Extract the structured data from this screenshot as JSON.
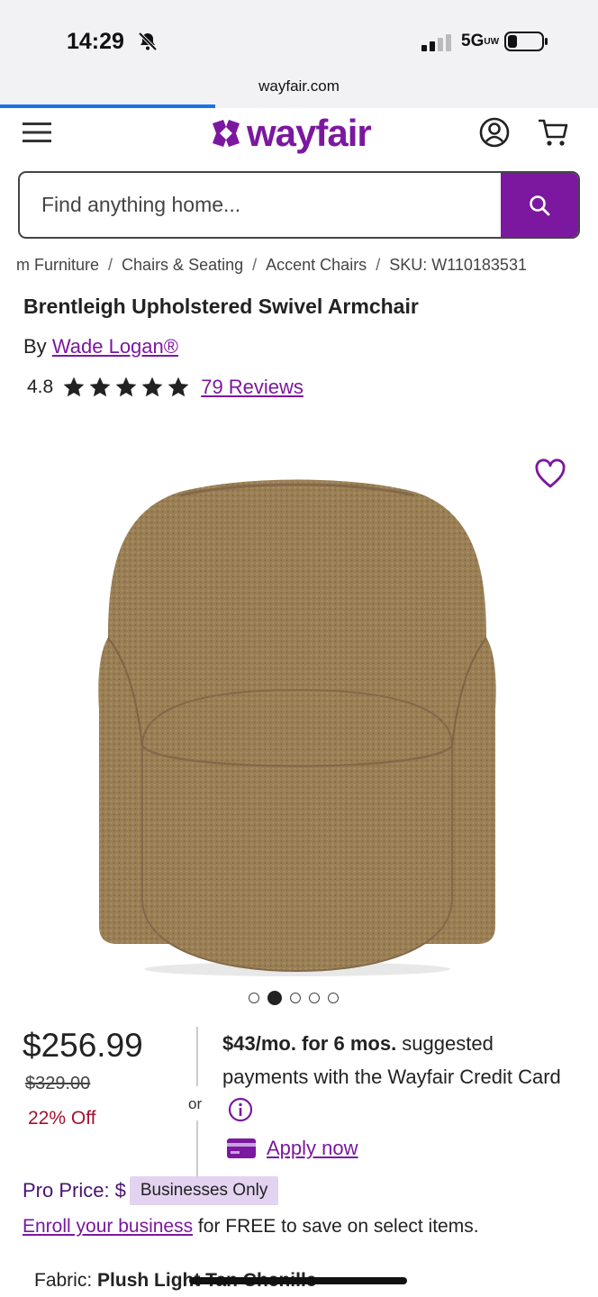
{
  "status_bar": {
    "time": "14:29",
    "network": "5G",
    "network_suffix": "UW"
  },
  "browser": {
    "url": "wayfair.com",
    "load_progress": 0.36
  },
  "header": {
    "logo": "wayfair"
  },
  "search": {
    "placeholder": "Find anything home..."
  },
  "breadcrumb": {
    "items": [
      "m Furniture",
      "Chairs & Seating",
      "Accent Chairs",
      "SKU: W110183531"
    ],
    "separator": "/"
  },
  "product": {
    "title": "Brentleigh Upholstered Swivel Armchair",
    "by_label": "By",
    "brand": "Wade Logan®",
    "rating": "4.8",
    "rating_stars": 5,
    "reviews": "79 Reviews"
  },
  "carousel": {
    "count": 5,
    "active_index": 1
  },
  "pricing": {
    "price": "$256.99",
    "old_price": "$329.00",
    "discount": "22% Off",
    "or_label": "or",
    "financing_bold": "$43/mo. for 6 mos.",
    "financing_text": " suggested payments with the Wayfair Credit Card",
    "apply_link": "Apply now"
  },
  "pro": {
    "label": "Pro Price:",
    "dollar": "$",
    "badge": "Businesses Only",
    "enroll_link": "Enroll your business",
    "enroll_text": " for FREE to save on select items."
  },
  "fabric": {
    "label": "Fabric:",
    "value": "Plush Light Tan Chenille"
  },
  "colors": {
    "brand": "#7b189f",
    "discount": "#a3122f",
    "badge_bg": "#e3d3f1",
    "fabric": "#9a7f55"
  }
}
